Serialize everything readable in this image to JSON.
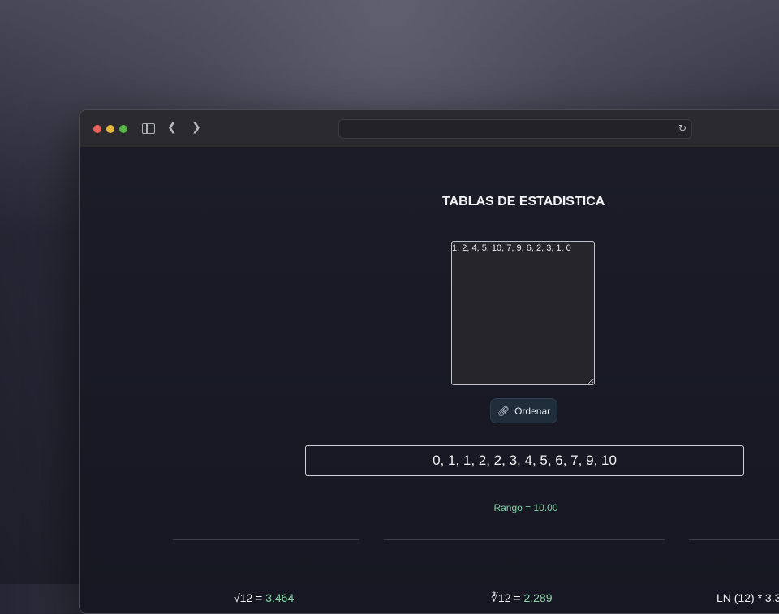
{
  "browser": {
    "url": ""
  },
  "page": {
    "title": "TABLAS DE ESTADISTICA",
    "input_value": "1, 2, 4, 5, 10, 7, 9, 6, 2, 3, 1, 0",
    "ordenar_label": "Ordenar",
    "sorted_values": "0, 1, 1, 2, 2, 3, 4, 5, 6, 7, 9, 10",
    "rango_label": "Rango = 10.00",
    "stats": [
      {
        "expr": "√12 = ",
        "value": "3.464"
      },
      {
        "expr": "∛12 = ",
        "value": "2.289"
      },
      {
        "expr": "LN (12) * 3.3",
        "value": ""
      }
    ]
  },
  "colors": {
    "accent_green": "#86d6a6",
    "button_bg": "#1f2d3a"
  },
  "icons": [
    "sidebar-icon",
    "back-icon",
    "forward-icon",
    "reload-icon",
    "link-icon"
  ]
}
